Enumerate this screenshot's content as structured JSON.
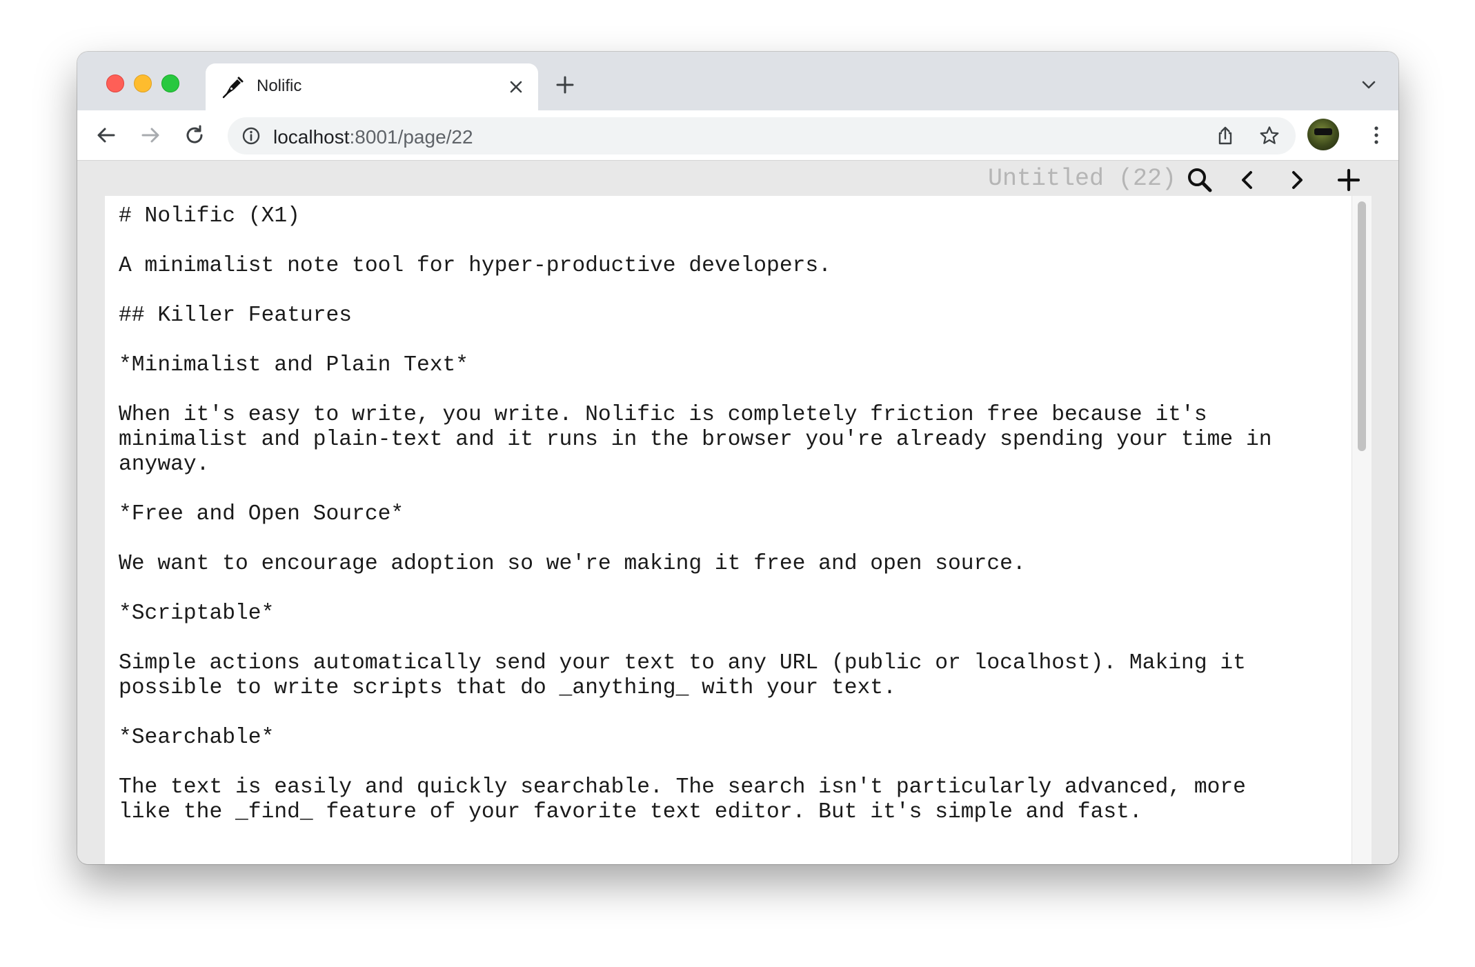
{
  "browser": {
    "tab": {
      "title": "Nolific",
      "icon": "pen-nib-icon"
    },
    "address": {
      "host": "localhost",
      "path": ":8001/page/22"
    }
  },
  "app": {
    "page_title": "Untitled (22)",
    "buttons": {
      "search": "search-icon",
      "previous": "chevron-left-icon",
      "next": "chevron-right-icon",
      "add": "plus-icon"
    }
  },
  "editor": {
    "text": "# Nolific (X1)\n\nA minimalist note tool for hyper-productive developers.\n\n## Killer Features\n\n*Minimalist and Plain Text*\n\nWhen it's easy to write, you write. Nolific is completely friction free because it's\nminimalist and plain-text and it runs in the browser you're already spending your time in\nanyway.\n\n*Free and Open Source*\n\nWe want to encourage adoption so we're making it free and open source.\n\n*Scriptable*\n\nSimple actions automatically send your text to any URL (public or localhost). Making it\npossible to write scripts that do _anything_ with your text.\n\n*Searchable*\n\nThe text is easily and quickly searchable. The search isn't particularly advanced, more\nlike the _find_ feature of your favorite text editor. But it's simple and fast."
  },
  "colors": {
    "tabstrip": "#dee1e6",
    "content_bg": "#e8e8e8",
    "title_gray": "#b5b5b5",
    "close_red": "#fe5f57",
    "minimize_yellow": "#febc2e",
    "zoom_green": "#28c840"
  }
}
